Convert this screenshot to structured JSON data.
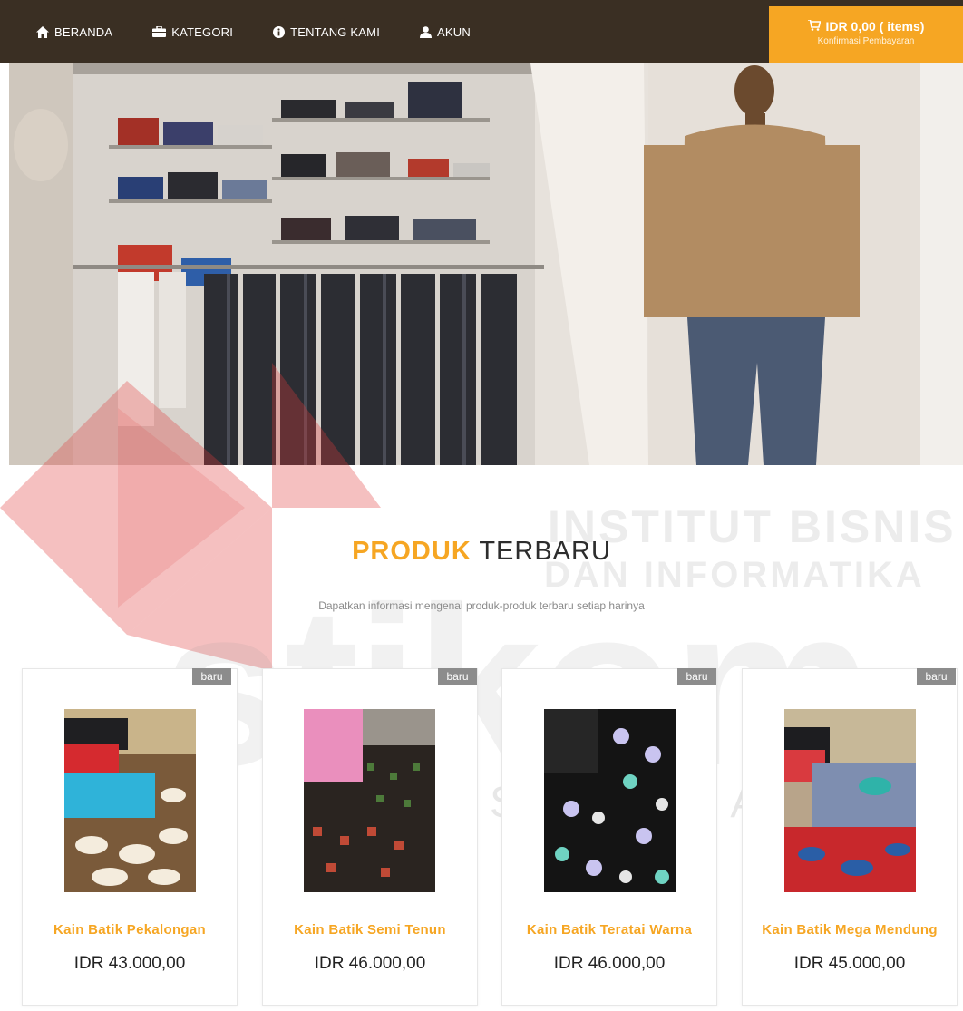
{
  "nav": {
    "items": [
      {
        "label": "BERANDA",
        "icon": "home-icon"
      },
      {
        "label": "KATEGORI",
        "icon": "briefcase-icon"
      },
      {
        "label": "TENTANG KAMI",
        "icon": "info-icon"
      },
      {
        "label": "AKUN",
        "icon": "user-icon"
      }
    ],
    "cart_total": "IDR 0,00 ( items)",
    "cart_sub": "Konfirmasi Pembayaran",
    "cart_icon": "cart-icon"
  },
  "colors": {
    "nav_bg": "#3a2f23",
    "accent": "#f6a623",
    "badge": "#8c8c8c"
  },
  "watermark": {
    "line1": "INSTITUT BISNIS",
    "line2": "DAN INFORMATIKA",
    "logo": "stikom",
    "city": "SURABAYA"
  },
  "section": {
    "title_highlight": "PRODUK",
    "title_rest": "TERBARU",
    "subtitle": "Dapatkan informasi mengenai produk-produk terbaru setiap harinya"
  },
  "products": [
    {
      "badge": "baru",
      "name": "Kain Batik Pekalongan",
      "price": "IDR 43.000,00"
    },
    {
      "badge": "baru",
      "name": "Kain Batik Semi Tenun",
      "price": "IDR 46.000,00"
    },
    {
      "badge": "baru",
      "name": "Kain Batik Teratai Warna",
      "price": "IDR 46.000,00"
    },
    {
      "badge": "baru",
      "name": "Kain Batik Mega Mendung",
      "price": "IDR 45.000,00"
    }
  ]
}
